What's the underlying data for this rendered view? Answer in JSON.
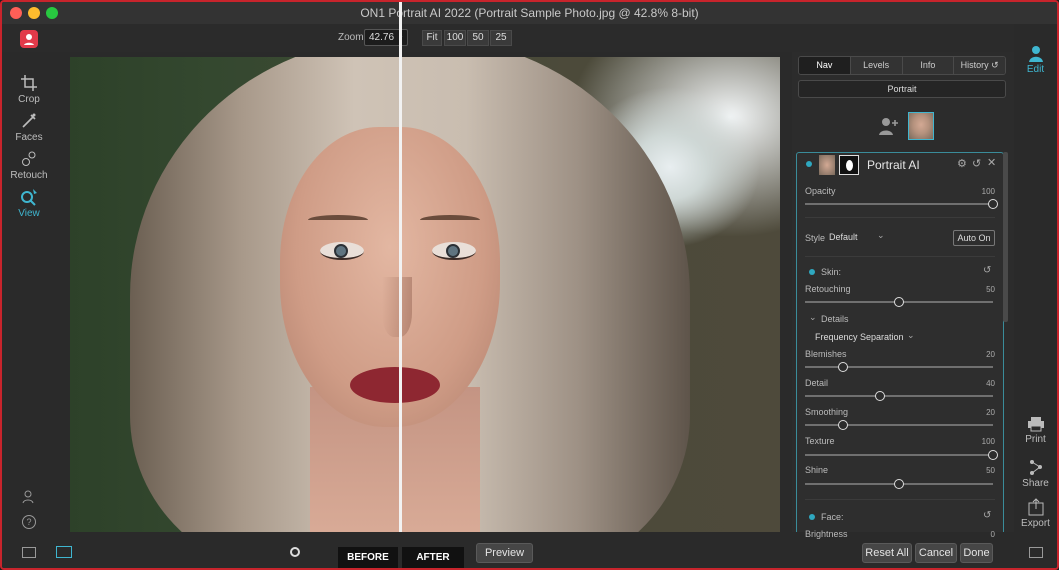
{
  "window": {
    "title": "ON1 Portrait AI 2022 (Portrait Sample Photo.jpg @ 42.8% 8-bit)"
  },
  "toolbar": {
    "zoom_label": "Zoom",
    "zoom_value": "42.76",
    "zoom_buttons": [
      "Fit",
      "100",
      "50",
      "25"
    ]
  },
  "left_tools": [
    {
      "label": "Crop",
      "icon": "crop-icon"
    },
    {
      "label": "Faces",
      "icon": "faces-icon"
    },
    {
      "label": "Retouch",
      "icon": "retouch-icon"
    },
    {
      "label": "View",
      "icon": "view-icon",
      "active": true
    }
  ],
  "right_tools": [
    {
      "label": "Edit",
      "icon": "edit-icon"
    },
    {
      "label": "Print",
      "icon": "print-icon"
    },
    {
      "label": "Share",
      "icon": "share-icon"
    },
    {
      "label": "Export",
      "icon": "export-icon"
    }
  ],
  "panel": {
    "tabs": [
      "Nav",
      "Levels",
      "Info",
      "History"
    ],
    "active_tab": "Nav",
    "portrait_label": "Portrait",
    "module": {
      "title": "Portrait AI",
      "opacity": {
        "label": "Opacity",
        "value": 100
      },
      "style": {
        "label": "Style",
        "value": "Default",
        "auto_button": "Auto On"
      },
      "skin": {
        "label": "Skin:",
        "retouching": {
          "label": "Retouching",
          "value": 50
        },
        "details_label": "Details",
        "method": "Frequency Separation",
        "blemishes": {
          "label": "Blemishes",
          "value": 20
        },
        "detail": {
          "label": "Detail",
          "value": 40
        },
        "smoothing": {
          "label": "Smoothing",
          "value": 20
        },
        "texture": {
          "label": "Texture",
          "value": 100
        },
        "shine": {
          "label": "Shine",
          "value": 50
        }
      },
      "face": {
        "label": "Face:",
        "brightness": {
          "label": "Brightness",
          "value": 0
        }
      }
    }
  },
  "bottom": {
    "before_label": "BEFORE",
    "after_label": "AFTER",
    "preview_button": "Preview",
    "reset_button": "Reset All",
    "cancel_button": "Cancel",
    "done_button": "Done"
  },
  "colors": {
    "accent": "#2fa8c0",
    "frame": "#c8242c",
    "lips": "#8e2731"
  }
}
